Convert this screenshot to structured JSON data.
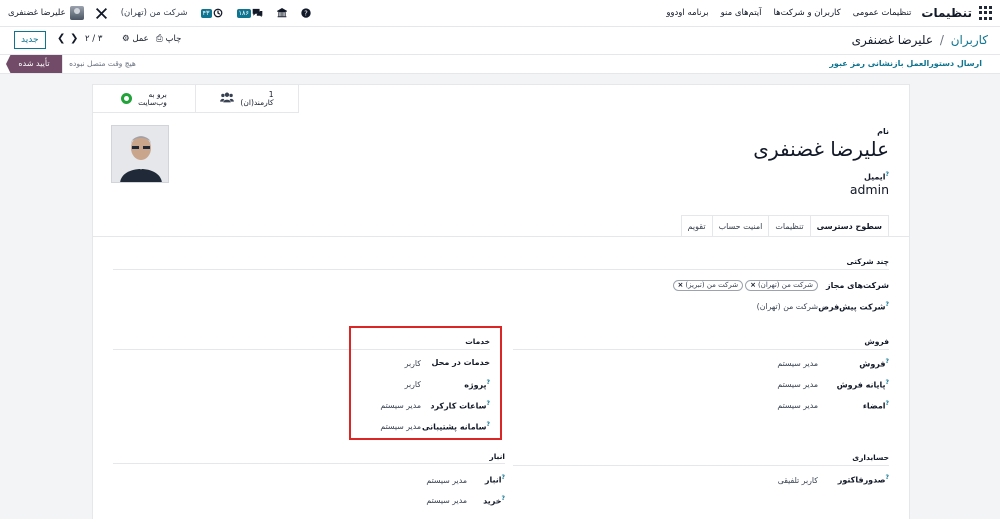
{
  "navbar": {
    "app_name": "تنظیمات",
    "menu": [
      "تنظیمات عمومی",
      "کاربران و شرکت‌ها",
      "آیتم‌های منو",
      "برنامه اودوو"
    ],
    "user_name": "علیرضا غضنفری",
    "company": "شرکت من (تهران)",
    "badge_chat": "۴۳",
    "badge_activity": "۱۸۶"
  },
  "control": {
    "breadcrumb_parent": "کاربران",
    "breadcrumb_sep": "/",
    "breadcrumb_current": "علیرضا غضنفری",
    "new_label": "جدید",
    "pager": "۲ / ۳",
    "action_label": "عمل",
    "print_label": "چاپ"
  },
  "status": {
    "reset_link": "ارسال دستورالعمل بازنشانی رمز عبور",
    "state_active": "تأیید شده",
    "state_next": "هیچ وقت متصل نبوده"
  },
  "smart_buttons": {
    "website_line1": "برو به",
    "website_line2": "وب‌سایت",
    "employee_count": "1",
    "employee_label": "کارمند(ان)"
  },
  "header": {
    "name_label": "نام",
    "name_value": "علیرضا غضنفری",
    "email_label": "ایمیل",
    "email_value": "admin"
  },
  "tabs": [
    "سطوح دسترسی",
    "تنظیمات",
    "امنیت حساب",
    "تقویم"
  ],
  "multi_company": {
    "title": "چند شرکتی",
    "allowed_label": "شرکت‌های مجاز",
    "allowed_tags": [
      "شرکت من (تبریز)",
      "شرکت من (تهران)"
    ],
    "default_label": "شرکت پیش‌فرض",
    "default_value": "شرکت من (تهران)"
  },
  "sales": {
    "title": "فروش",
    "rows": [
      {
        "label": "فروش",
        "value": "مدیر سیستم"
      },
      {
        "label": "پایانه فروش",
        "value": "مدیر سیستم"
      },
      {
        "label": "امضاء",
        "value": "مدیر سیستم"
      }
    ]
  },
  "services": {
    "title": "خدمات",
    "rows": [
      {
        "label": "خدمات در محل",
        "value": "کاربر"
      },
      {
        "label": "پروژه",
        "value": "کاربر"
      },
      {
        "label": "ساعات کارکرد",
        "value": "مدیر سیستم"
      },
      {
        "label": "سامانه پشتیبانی",
        "value": "مدیر سیستم"
      }
    ]
  },
  "accounting": {
    "title": "حسابداری",
    "rows": [
      {
        "label": "صدورفاکتور",
        "value": "کاربر تلفیقی"
      }
    ]
  },
  "inventory": {
    "title": "انبار",
    "rows": [
      {
        "label": "انبار",
        "value": "مدیر سیستم"
      },
      {
        "label": "خرید",
        "value": "مدیر سیستم"
      }
    ]
  },
  "colors": {
    "primary": "#714b67",
    "link": "#0e7490",
    "highlight": "#dc2626"
  }
}
